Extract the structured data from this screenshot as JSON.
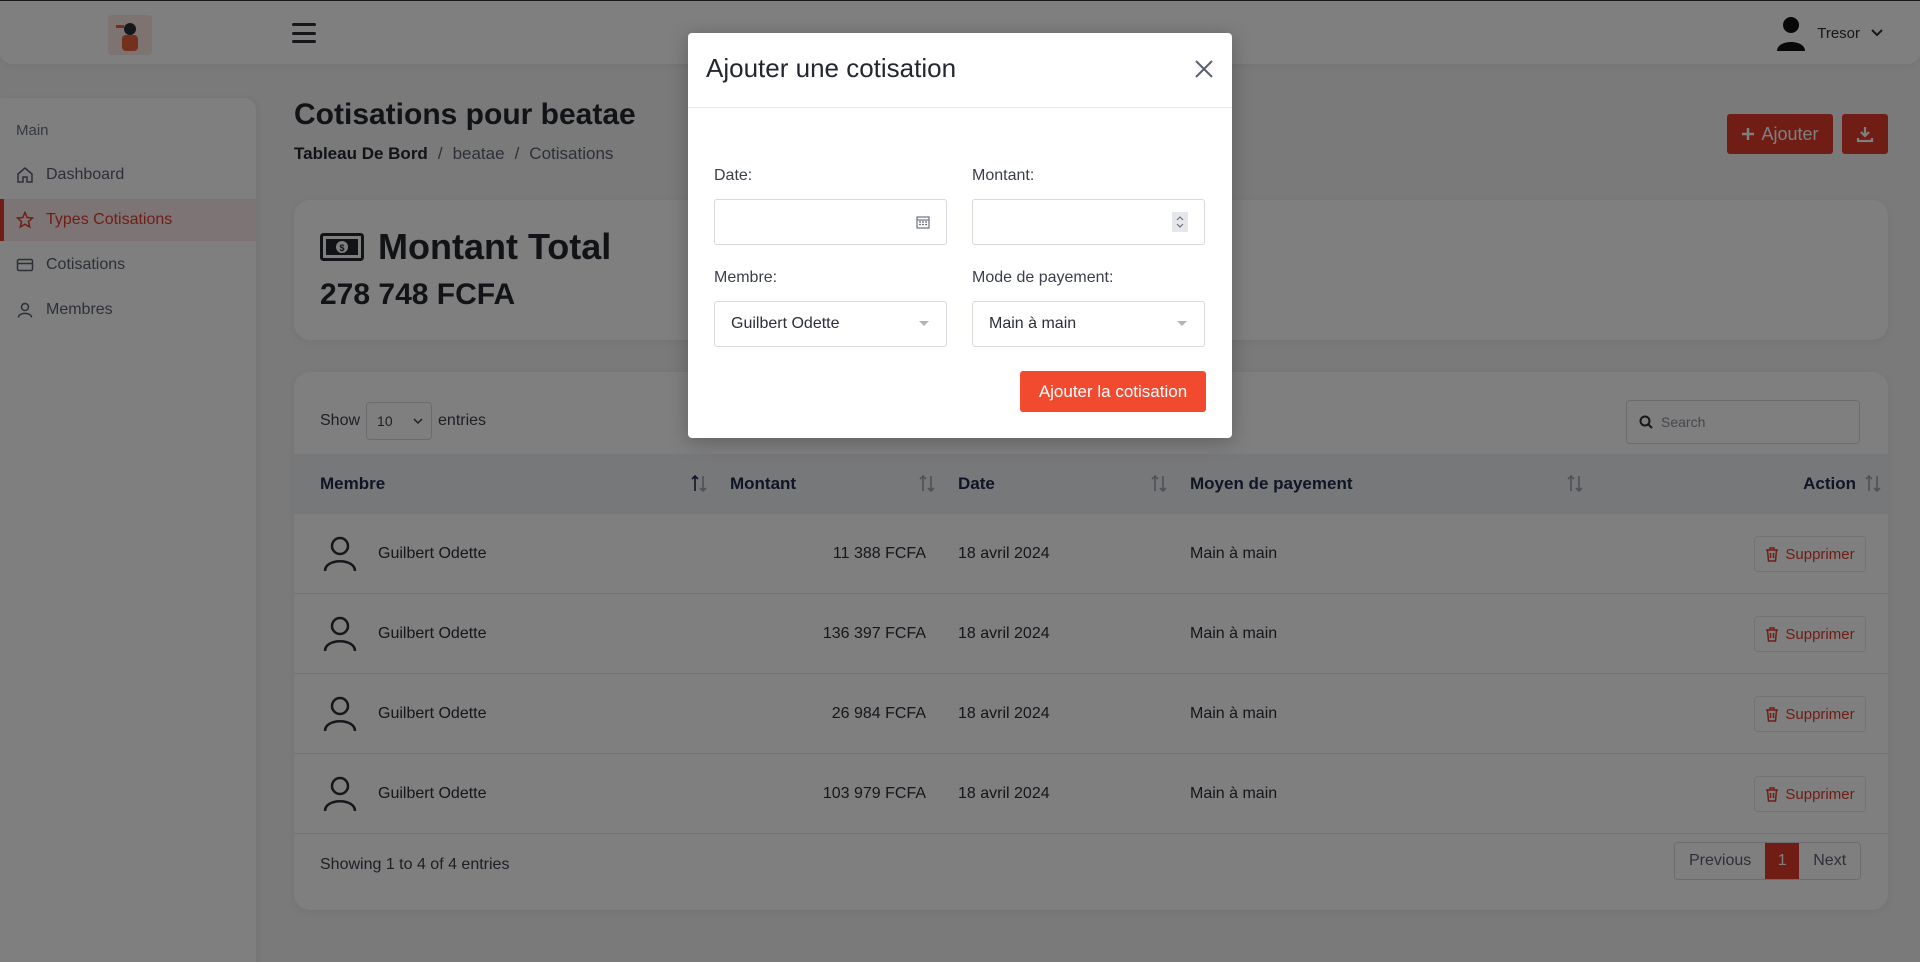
{
  "colors": {
    "accent": "#e03b2b",
    "heading": "#23272f",
    "table_header_text": "#1f2a4a"
  },
  "header": {
    "user_name": "Tresor"
  },
  "sidebar": {
    "section_label": "Main",
    "items": [
      {
        "label": "Dashboard",
        "icon": "home-icon",
        "active": false
      },
      {
        "label": "Types Cotisations",
        "icon": "star-icon",
        "active": true
      },
      {
        "label": "Cotisations",
        "icon": "credit-card-icon",
        "active": false
      },
      {
        "label": "Membres",
        "icon": "user-icon",
        "active": false
      }
    ]
  },
  "page": {
    "title": "Cotisations pour beatae",
    "breadcrumb": [
      "Tableau De Bord",
      "/",
      "beatae",
      "/",
      "Cotisations"
    ],
    "add_label": "Ajouter"
  },
  "total": {
    "title": "Montant Total",
    "amount": "278 748 FCFA"
  },
  "table": {
    "show_label": "Show",
    "entries_label": "entries",
    "page_size": "10",
    "search_placeholder": "Search",
    "columns": [
      "Membre",
      "Montant",
      "Date",
      "Moyen de payement",
      "Action"
    ],
    "rows": [
      {
        "membre": "Guilbert Odette",
        "montant": "11 388 FCFA",
        "date": "18 avril 2024",
        "moyen": "Main à main",
        "action": "Supprimer"
      },
      {
        "membre": "Guilbert Odette",
        "montant": "136 397 FCFA",
        "date": "18 avril 2024",
        "moyen": "Main à main",
        "action": "Supprimer"
      },
      {
        "membre": "Guilbert Odette",
        "montant": "26 984 FCFA",
        "date": "18 avril 2024",
        "moyen": "Main à main",
        "action": "Supprimer"
      },
      {
        "membre": "Guilbert Odette",
        "montant": "103 979 FCFA",
        "date": "18 avril 2024",
        "moyen": "Main à main",
        "action": "Supprimer"
      }
    ],
    "info": "Showing 1 to 4 of 4 entries",
    "pagination": {
      "previous": "Previous",
      "current": "1",
      "next": "Next"
    }
  },
  "modal": {
    "title": "Ajouter une cotisation",
    "date_label": "Date:",
    "date_value": "",
    "montant_label": "Montant:",
    "montant_value": "",
    "membre_label": "Membre:",
    "membre_value": "Guilbert Odette",
    "mode_label": "Mode de payement:",
    "mode_value": "Main à main",
    "submit_label": "Ajouter la cotisation"
  }
}
